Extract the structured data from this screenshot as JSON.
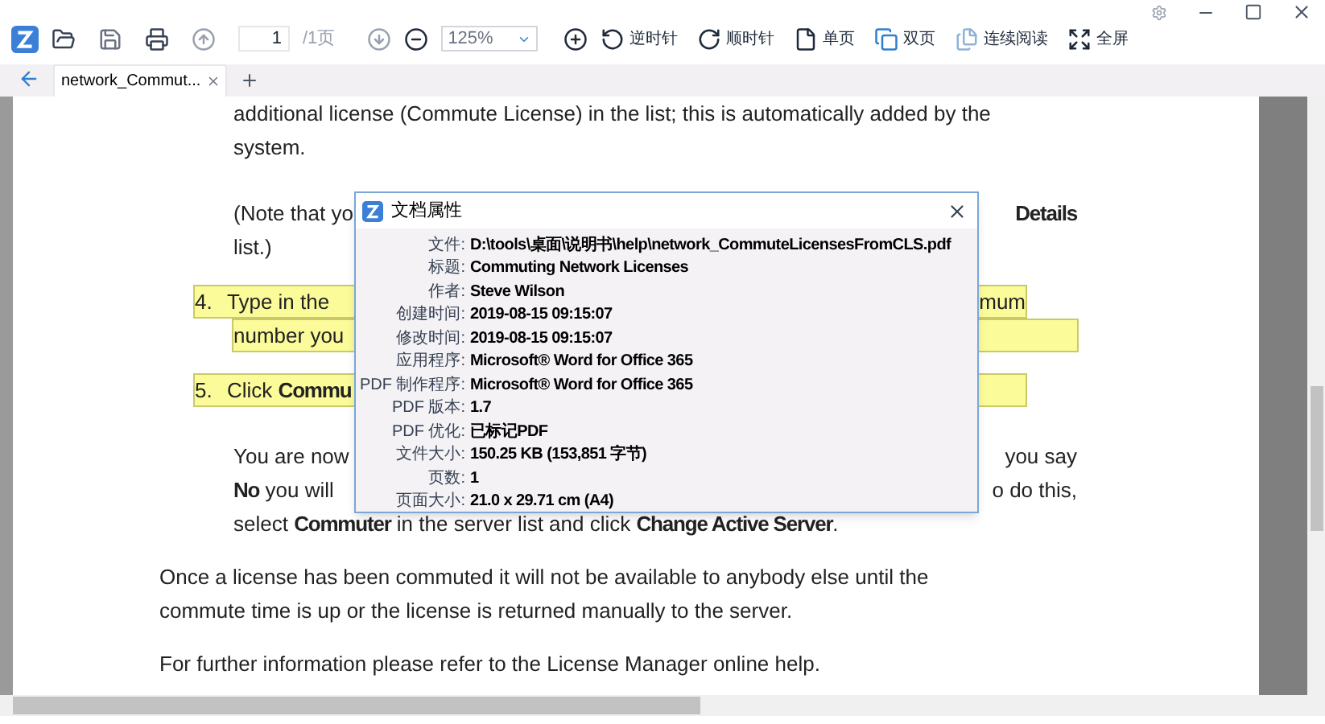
{
  "toolbar": {
    "page_input": "1",
    "page_total": "/1页",
    "zoom": "125%",
    "buttons": [
      {
        "kind": "rotate_ccw",
        "label": "逆时针"
      },
      {
        "kind": "rotate_cw",
        "label": "顺时针"
      },
      {
        "kind": "single",
        "label": "单页"
      },
      {
        "kind": "double",
        "label": "双页"
      },
      {
        "kind": "continuous",
        "label": "连续阅读"
      },
      {
        "kind": "fullscreen",
        "label": "全屏"
      }
    ]
  },
  "tabs": [
    {
      "label": "network_Commut...",
      "selected": true
    }
  ],
  "document": {
    "blocks": [
      {
        "kind": "text",
        "lines": [
          {
            "left": "additional license (Commute License) in the list; this is automatically added by the"
          },
          {
            "left": "system."
          }
        ]
      },
      {
        "kind": "text",
        "lines": [
          {
            "left": "(Note that yo",
            "right": "**Details**"
          },
          {
            "left": "list.)"
          }
        ]
      },
      {
        "kind": "item",
        "number": "4.",
        "highlight": true,
        "lines": [
          {
            "left": "Type in the",
            "right": "mum"
          },
          {
            "left": "number you"
          }
        ]
      },
      {
        "kind": "item",
        "number": "5.",
        "highlight": true,
        "lines": [
          {
            "left": "Click **Commu**"
          }
        ]
      },
      {
        "kind": "text",
        "lines": [
          {
            "left": "You are now",
            "right": "you say"
          },
          {
            "left": "**No** you will",
            "right": "o do this,"
          },
          {
            "left": "select **Commuter** in the server list and click **Change Active Server**."
          }
        ]
      },
      {
        "kind": "para",
        "lines": [
          {
            "left": "Once a license has been commuted it will not be available to anybody else until the"
          },
          {
            "left": "commute time is up or the license is returned manually to the server."
          }
        ]
      },
      {
        "kind": "para",
        "lines": [
          {
            "left": "For further information please refer to the License Manager online help."
          }
        ]
      }
    ]
  },
  "dialog": {
    "title": "文档属性",
    "fields": [
      {
        "label": "文件:",
        "value": "D:\\tools\\桌面\\说明书\\help\\network_CommuteLicensesFromCLS.pdf"
      },
      {
        "label": "标题:",
        "value": "Commuting Network Licenses"
      },
      {
        "label": "作者:",
        "value": "Steve Wilson"
      },
      {
        "label": "创建时间:",
        "value": "2019-08-15 09:15:07"
      },
      {
        "label": "修改时间:",
        "value": "2019-08-15 09:15:07"
      },
      {
        "label": "应用程序:",
        "value": "Microsoft® Word for Office 365"
      },
      {
        "label": "PDF 制作程序:",
        "value": "Microsoft® Word for Office 365"
      },
      {
        "label": "PDF 版本:",
        "value": "1.7"
      },
      {
        "label": "PDF 优化:",
        "value": "已标记PDF"
      },
      {
        "label": "文件大小:",
        "value": "150.25 KB (153,851 字节)"
      },
      {
        "label": "页数:",
        "value": "1"
      },
      {
        "label": "页面大小:",
        "value": "21.0 x 29.71 cm (A4)"
      }
    ]
  }
}
